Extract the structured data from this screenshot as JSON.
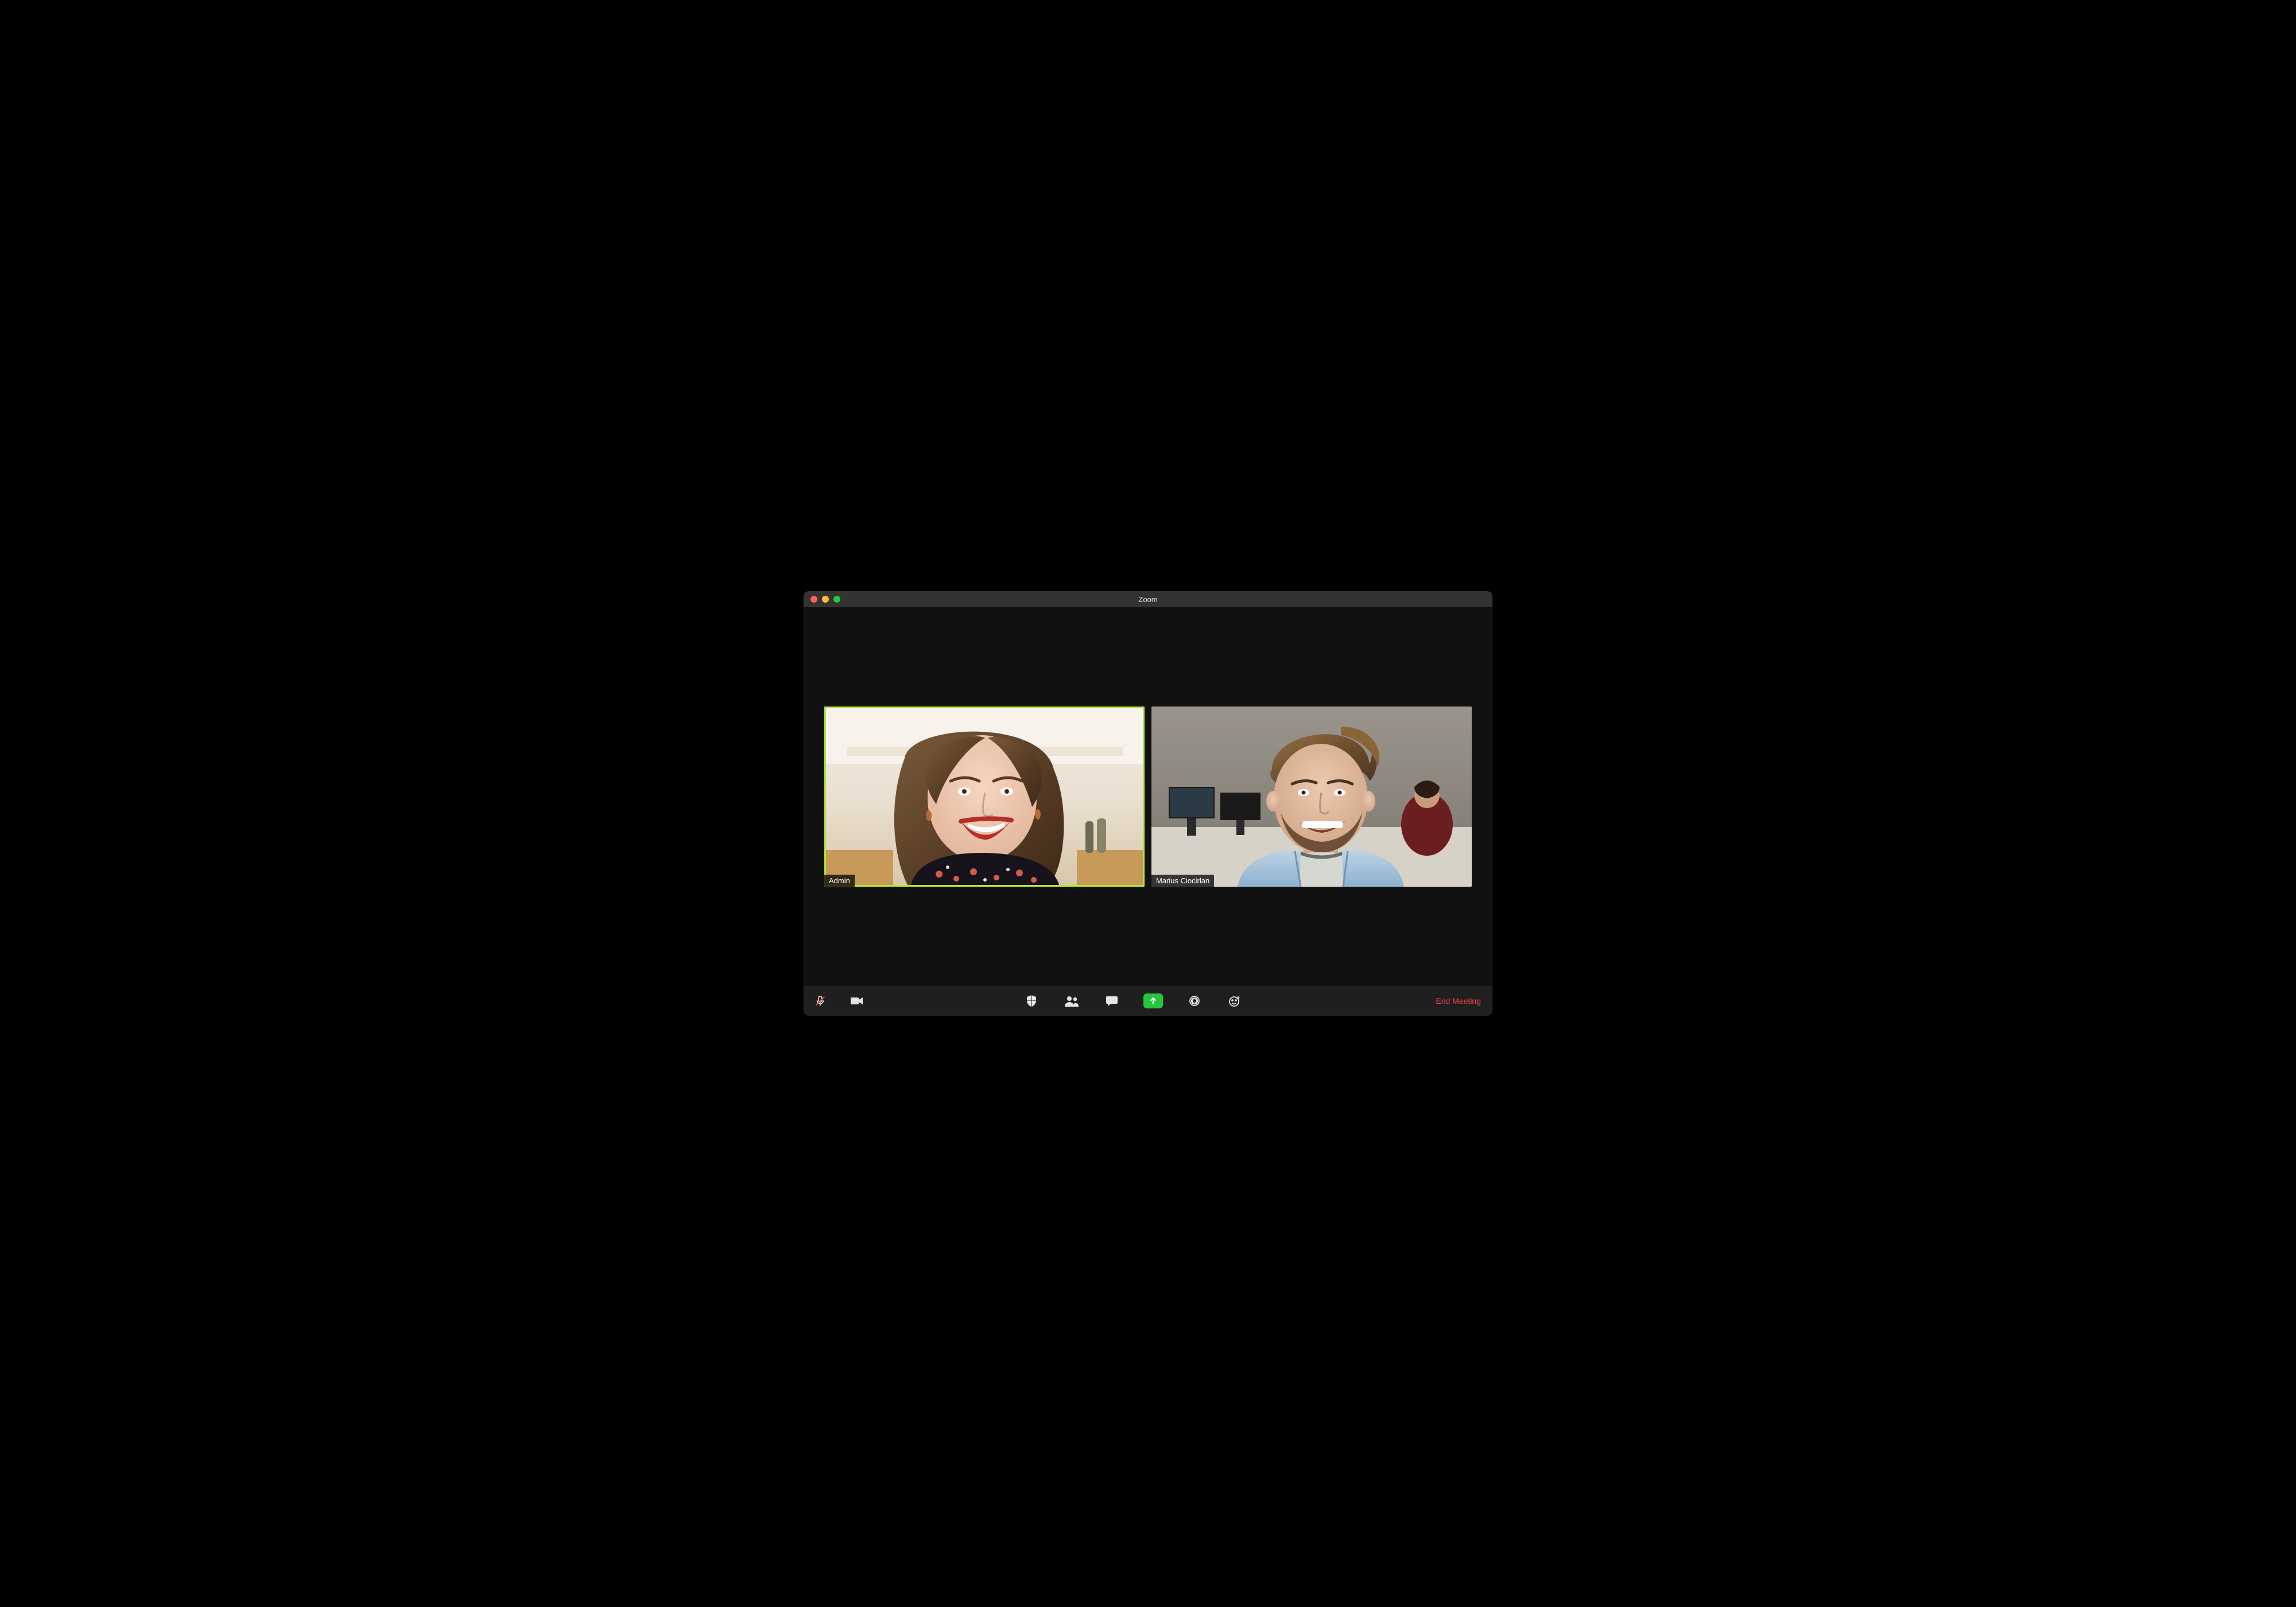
{
  "window": {
    "title": "Zoom",
    "traffic_lights": {
      "close": "#ff5f57",
      "minimize": "#febc2e",
      "maximize": "#28c840"
    }
  },
  "participants": [
    {
      "name": "Admin",
      "is_speaking": true
    },
    {
      "name": "Marius Ciocirlan",
      "is_speaking": false
    }
  ],
  "toolbar": {
    "mute_label": "Mute",
    "mute_state": "muted",
    "video_label": "Start Video",
    "security_label": "Security",
    "participants_label": "Participants",
    "chat_label": "Chat",
    "share_label": "Share Screen",
    "record_label": "Record",
    "reactions_label": "Reactions",
    "end_label": "End Meeting"
  },
  "colors": {
    "active_border": "#b6e43c",
    "share_green": "#24c63e",
    "end_red": "#f9454a"
  }
}
